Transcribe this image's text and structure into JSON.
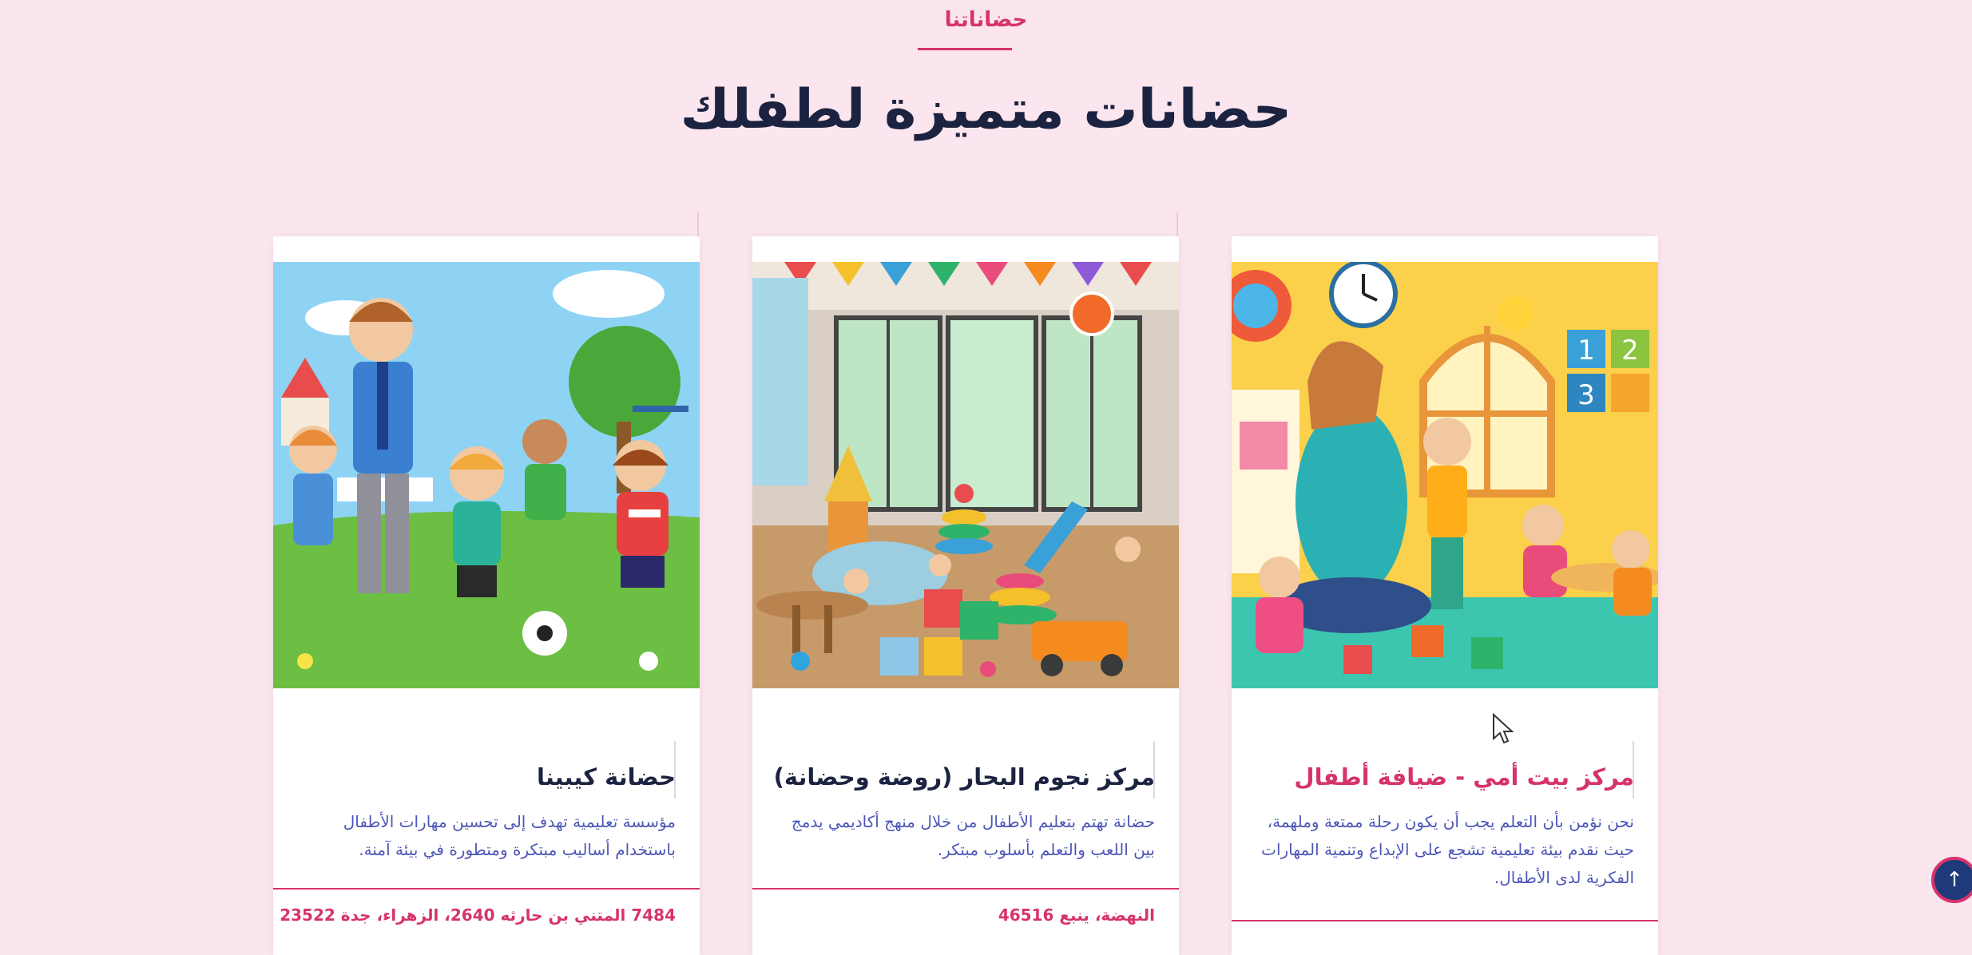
{
  "section": {
    "eyebrow": "حضاناتنا",
    "title": "حضانات متميزة لطفلك"
  },
  "cards": [
    {
      "title": "مركز بيت أمي - ضيافة أطفال",
      "description": "نحن نؤمن بأن التعلم يجب أن يكون رحلة ممتعة وملهمة، حيث نقدم بيئة تعليمية تشجع على الإبداع وتنمية المهارات الفكرية لدى الأطفال.",
      "address": ""
    },
    {
      "title": "مركز نجوم البحار (روضة وحضانة)",
      "description": "حضانة تهتم بتعليم الأطفال من خلال منهج أكاديمي يدمج بين اللعب والتعلم بأسلوب مبتكر.",
      "address": "النهضة، ينبع 46516"
    },
    {
      "title": "حضانة كيبينا",
      "description": "مؤسسة تعليمية تهدف إلى تحسين مهارات الأطفال باستخدام أساليب مبتكرة ومتطورة في بيئة آمنة.",
      "address": "7484 المتني بن حارثه 2640، الزهراء، جدة 23522"
    }
  ],
  "back_to_top": {
    "icon": "arrow-up-icon",
    "glyph": "↑"
  },
  "colors": {
    "background": "#fbe5ee",
    "accent": "#d6336c",
    "heading": "#1c2340",
    "body_text": "#4c57b8",
    "button": "#1e3a7a"
  }
}
